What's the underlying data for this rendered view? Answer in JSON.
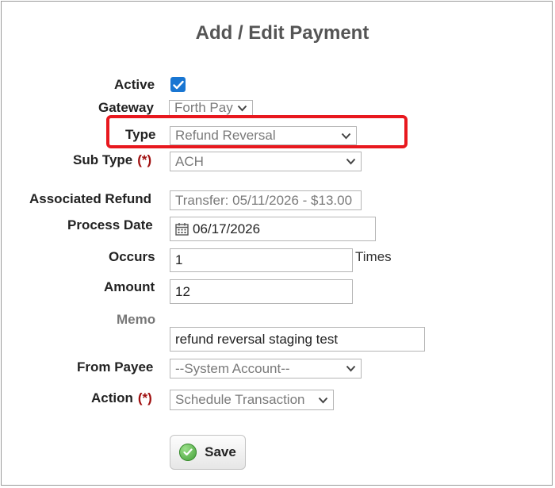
{
  "title": "Add / Edit Payment",
  "form": {
    "active": {
      "label": "Active",
      "checked": true
    },
    "gateway": {
      "label": "Gateway",
      "value": "Forth Pay"
    },
    "type": {
      "label": "Type",
      "value": "Refund Reversal"
    },
    "sub_type": {
      "label": "Sub Type",
      "required": "(*)",
      "value": "ACH"
    },
    "associated_refund": {
      "label": "Associated Refund",
      "value": "Transfer: 05/11/2026 - $13.00"
    },
    "process_date": {
      "label": "Process Date",
      "value": "06/17/2026"
    },
    "occurs": {
      "label": "Occurs",
      "value": "1",
      "suffix": "Times"
    },
    "amount": {
      "label": "Amount",
      "value": "12"
    },
    "memo": {
      "label": "Memo",
      "value": "refund reversal staging test"
    },
    "from_payee": {
      "label": "From Payee",
      "value": "--System Account--"
    },
    "action": {
      "label": "Action",
      "required": "(*)",
      "value": "Schedule Transaction"
    }
  },
  "save_label": "Save",
  "colors": {
    "checkbox": "#1976d2",
    "highlight": "#e8181e",
    "required": "#a01010"
  }
}
